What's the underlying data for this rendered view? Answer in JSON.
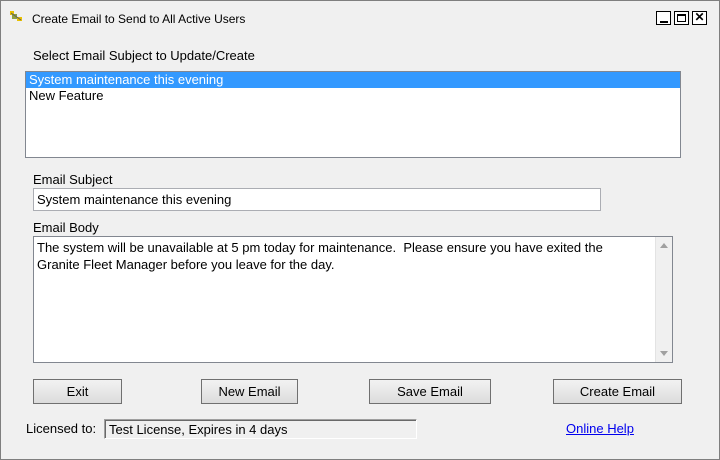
{
  "window": {
    "title": "Create Email to Send to All Active Users",
    "controls": [
      "minimize-icon",
      "maximize-icon",
      "close-icon"
    ],
    "close_glyph": "✕"
  },
  "subject_list": {
    "label": "Select Email Subject to Update/Create",
    "items": [
      {
        "text": "System maintenance this evening",
        "selected": true
      },
      {
        "text": "New Feature",
        "selected": false
      }
    ]
  },
  "email_subject": {
    "label": "Email Subject",
    "value": "System maintenance this evening"
  },
  "email_body": {
    "label": "Email Body",
    "value": "The system will be unavailable at 5 pm today for maintenance.  Please ensure you have exited the\nGranite Fleet Manager before you leave for the day."
  },
  "buttons": {
    "exit": "Exit",
    "new_email": "New Email",
    "save_email": "Save Email",
    "create_email": "Create Email"
  },
  "license": {
    "label": "Licensed to:",
    "value": "Test License, Expires in 4 days"
  },
  "help_link": "Online Help",
  "colors": {
    "selection": "#3399ff",
    "link": "#0000ee",
    "window_bg": "#f0f0f0"
  }
}
